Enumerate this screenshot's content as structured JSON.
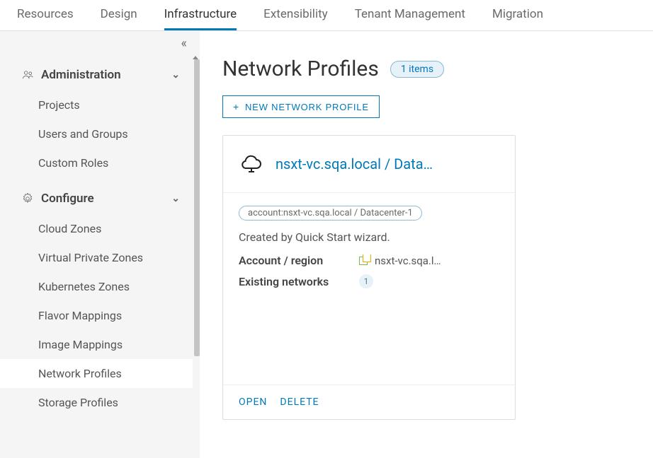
{
  "tabs": {
    "resources": "Resources",
    "design": "Design",
    "infrastructure": "Infrastructure",
    "extensibility": "Extensibility",
    "tenant": "Tenant Management",
    "migration": "Migration"
  },
  "sidebar": {
    "administration": {
      "label": "Administration",
      "items": {
        "projects": "Projects",
        "users": "Users and Groups",
        "roles": "Custom Roles"
      }
    },
    "configure": {
      "label": "Configure",
      "items": {
        "cloud_zones": "Cloud Zones",
        "vpz": "Virtual Private Zones",
        "k8s": "Kubernetes Zones",
        "flavor": "Flavor Mappings",
        "image": "Image Mappings",
        "netprof": "Network Profiles",
        "storprof": "Storage Profiles"
      }
    }
  },
  "page": {
    "title": "Network Profiles",
    "count": "1 items",
    "new_button": "NEW NETWORK PROFILE"
  },
  "card": {
    "title": "nsxt-vc.sqa.local / Data…",
    "tag": "account:nsxt-vc.sqa.local / Datacenter-1",
    "description": "Created by Quick Start wizard.",
    "account_label": "Account / region",
    "account_value": "nsxt-vc.sqa.l…",
    "existing_label": "Existing networks",
    "existing_count": "1",
    "open": "OPEN",
    "delete": "DELETE"
  }
}
